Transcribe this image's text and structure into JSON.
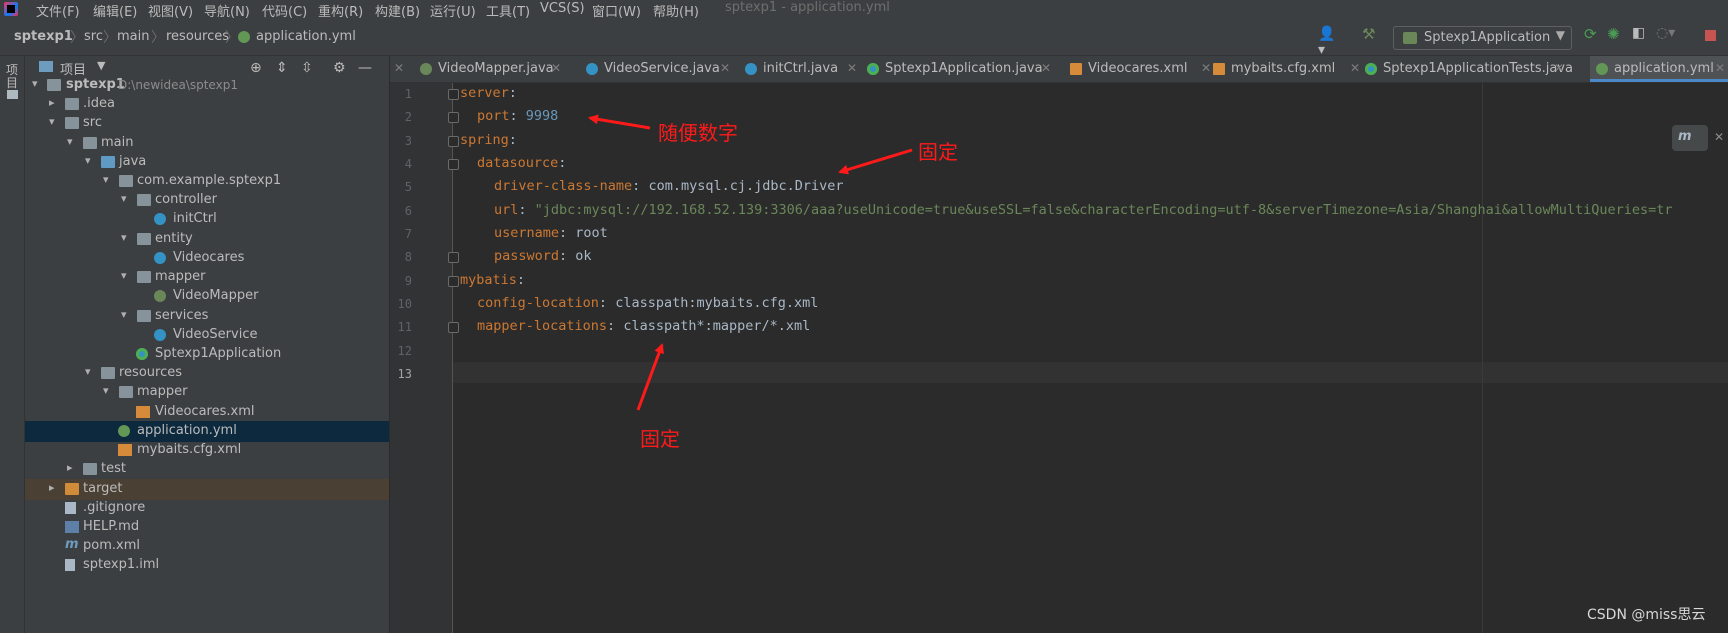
{
  "menubar": {
    "items": [
      "文件(F)",
      "编辑(E)",
      "视图(V)",
      "导航(N)",
      "代码(C)",
      "重构(R)",
      "构建(B)",
      "运行(U)",
      "工具(T)",
      "VCS(S)",
      "窗口(W)",
      "帮助(H)"
    ],
    "window_title": "sptexp1 - application.yml"
  },
  "breadcrumb": [
    "sptexp1",
    "src",
    "main",
    "resources",
    "application.yml"
  ],
  "run_config": "Sptexp1Application",
  "tool_strip_label": "项目",
  "project_panel": {
    "title": "项目",
    "tree": [
      {
        "label": "sptexp1",
        "path": "D:\\newidea\\sptexp1",
        "icon": "folder-icon"
      },
      {
        "label": ".idea",
        "icon": "folder-icon"
      },
      {
        "label": "src",
        "icon": "folder-icon"
      },
      {
        "label": "main",
        "icon": "folder-icon"
      },
      {
        "label": "java",
        "icon": "source-folder-icon"
      },
      {
        "label": "com.example.sptexp1",
        "icon": "package-icon"
      },
      {
        "label": "controller",
        "icon": "package-icon"
      },
      {
        "label": "initCtrl",
        "icon": "class-icon"
      },
      {
        "label": "entity",
        "icon": "package-icon"
      },
      {
        "label": "Videocares",
        "icon": "class-icon"
      },
      {
        "label": "mapper",
        "icon": "package-icon"
      },
      {
        "label": "VideoMapper",
        "icon": "interface-icon"
      },
      {
        "label": "services",
        "icon": "package-icon"
      },
      {
        "label": "VideoService",
        "icon": "class-icon"
      },
      {
        "label": "Sptexp1Application",
        "icon": "spring-boot-icon"
      },
      {
        "label": "resources",
        "icon": "resources-folder-icon"
      },
      {
        "label": "mapper",
        "icon": "folder-icon"
      },
      {
        "label": "Videocares.xml",
        "icon": "xml-file-icon"
      },
      {
        "label": "application.yml",
        "icon": "yml-file-icon"
      },
      {
        "label": "mybaits.cfg.xml",
        "icon": "xml-file-icon"
      },
      {
        "label": "test",
        "icon": "folder-icon"
      },
      {
        "label": "target",
        "icon": "excluded-folder-icon"
      },
      {
        "label": ".gitignore",
        "icon": "text-file-icon"
      },
      {
        "label": "HELP.md",
        "icon": "markdown-file-icon"
      },
      {
        "label": "pom.xml",
        "icon": "maven-icon"
      },
      {
        "label": "sptexp1.iml",
        "icon": "module-file-icon"
      }
    ]
  },
  "tabs": [
    {
      "label": "VideoMapper.java",
      "icon": "interface-icon",
      "color": "#6a8759"
    },
    {
      "label": "VideoService.java",
      "icon": "class-icon",
      "color": "#3592c4"
    },
    {
      "label": "initCtrl.java",
      "icon": "class-icon",
      "color": "#3592c4"
    },
    {
      "label": "Sptexp1Application.java",
      "icon": "spring-boot-icon",
      "color": "#3592c4"
    },
    {
      "label": "Videocares.xml",
      "icon": "xml-file-icon",
      "color": "#d68b3b"
    },
    {
      "label": "mybaits.cfg.xml",
      "icon": "xml-file-icon",
      "color": "#d68b3b"
    },
    {
      "label": "Sptexp1ApplicationTests.java",
      "icon": "spring-boot-icon",
      "color": "#3592c4"
    },
    {
      "label": "application.yml",
      "icon": "yml-file-icon",
      "color": "#629755"
    }
  ],
  "editor": {
    "line_numbers": [
      "1",
      "2",
      "3",
      "4",
      "5",
      "6",
      "7",
      "8",
      "9",
      "10",
      "11",
      "12",
      "13"
    ],
    "lines": [
      {
        "key": "server",
        "value": ""
      },
      {
        "key": "port",
        "value": "9998"
      },
      {
        "key": "spring",
        "value": ""
      },
      {
        "key": "datasource",
        "value": ""
      },
      {
        "key": "driver-class-name",
        "value": "com.mysql.cj.jdbc.Driver"
      },
      {
        "key": "url",
        "value": "\"jdbc:mysql://192.168.52.139:3306/aaa?useUnicode=true&useSSL=false&characterEncoding=utf-8&serverTimezone=Asia/Shanghai&allowMultiQueries=tr"
      },
      {
        "key": "username",
        "value": "root"
      },
      {
        "key": "password",
        "value": "ok"
      },
      {
        "key": "mybatis",
        "value": ""
      },
      {
        "key": "config-location",
        "value": "classpath:mybaits.cfg.xml"
      },
      {
        "key": "mapper-locations",
        "value": "classpath*:mapper/*.xml"
      }
    ]
  },
  "annotations": {
    "port_note": "随便数字",
    "driver_note": "固定",
    "mapper_note": "固定",
    "color": "#ff1a1a"
  },
  "watermark": "CSDN @miss思云"
}
